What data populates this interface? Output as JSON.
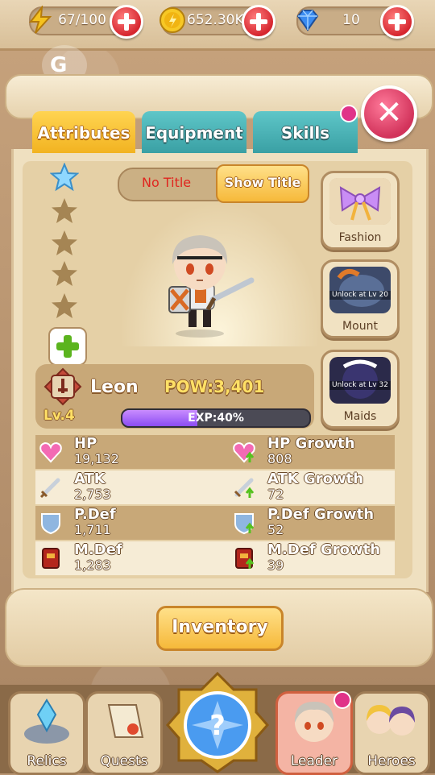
{
  "resources": {
    "energy": {
      "value": "67/100",
      "icon": "lightning-icon"
    },
    "gold": {
      "value": "652.30K",
      "icon": "gold-coin-icon"
    },
    "gems": {
      "value": "10",
      "icon": "blue-gem-icon"
    }
  },
  "tabs": [
    {
      "label": "Attributes",
      "active": true
    },
    {
      "label": "Equipment",
      "active": false
    },
    {
      "label": "Skills",
      "active": false
    }
  ],
  "title": {
    "current": "No Title",
    "show_button": "Show Title"
  },
  "stars": {
    "filled": 1,
    "total": 5
  },
  "side_buttons": [
    {
      "label": "Fashion",
      "locked": false,
      "lock_text": ""
    },
    {
      "label": "Mount",
      "locked": true,
      "lock_text": "Unlock at Lv 20"
    },
    {
      "label": "Maids",
      "locked": true,
      "lock_text": "Unlock at Lv 32"
    }
  ],
  "hero": {
    "name": "Leon",
    "power_label": "POW:",
    "power_value": "3,401",
    "level": "Lv.4",
    "exp_text": "EXP:40%",
    "exp_fraction": 0.4
  },
  "stats": [
    {
      "name": "HP",
      "value": "19,132",
      "growth_name": "HP Growth",
      "growth_value": "808",
      "icon": "heart-icon"
    },
    {
      "name": "ATK",
      "value": "2,753",
      "growth_name": "ATK Growth",
      "growth_value": "72",
      "icon": "sword-icon"
    },
    {
      "name": "P.Def",
      "value": "1,711",
      "growth_name": "P.Def Growth",
      "growth_value": "52",
      "icon": "shield-icon"
    },
    {
      "name": "M.Def",
      "value": "1,283",
      "growth_name": "M.Def Growth",
      "growth_value": "39",
      "icon": "spellbook-icon"
    }
  ],
  "inventory_label": "Inventory",
  "nav": [
    {
      "label": "Relics",
      "active": false
    },
    {
      "label": "Quests",
      "active": false
    },
    {
      "label": "",
      "active": false
    },
    {
      "label": "Leader",
      "active": true
    },
    {
      "label": "Heroes",
      "active": false
    }
  ],
  "colors": {
    "accent_gold": "#f6b93a",
    "tab_teal": "#3aa0a4",
    "close_pink": "#d2335b",
    "notify_dot": "#e03389"
  }
}
